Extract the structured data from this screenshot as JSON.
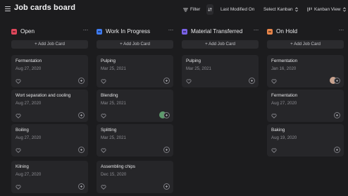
{
  "header": {
    "title": "Job cards board",
    "filter_label": "Filter",
    "sort_label": "Last Modified On",
    "select_kanban_label": "Select Kanban",
    "view_label": "Kanban View"
  },
  "columns": [
    {
      "title": "Open",
      "color": "#e0485c",
      "add_label": "+ Add Job Card",
      "cards": [
        {
          "title": "Fermentation",
          "date": "Aug 27, 2020"
        },
        {
          "title": "Wort separation and cooling",
          "date": "Aug 27, 2020"
        },
        {
          "title": "Boiling",
          "date": "Aug 27, 2020"
        },
        {
          "title": "Kilning",
          "date": "Aug 27, 2020"
        }
      ]
    },
    {
      "title": "Work In Progress",
      "color": "#3e7bf0",
      "add_label": "+ Add Job Card",
      "cards": [
        {
          "title": "Pulping",
          "date": "Mar 25, 2021"
        },
        {
          "title": "Blending",
          "date": "Mar 25, 2021"
        },
        {
          "title": "Splitting",
          "date": "Mar 25, 2021"
        },
        {
          "title": "Assembling chips",
          "date": "Dec 15, 2020"
        }
      ]
    },
    {
      "title": "Material Transferred",
      "color": "#7a62e6",
      "add_label": "+ Add Job Card",
      "cards": [
        {
          "title": "Pulping",
          "date": "Mar 25, 2021"
        }
      ]
    },
    {
      "title": "On Hold",
      "color": "#e9864a",
      "add_label": "+ Add Job Card",
      "cards": [
        {
          "title": "Fermentation",
          "date": "Jan 16, 2020"
        },
        {
          "title": "Fermentation",
          "date": "Aug 27, 2020"
        },
        {
          "title": "Baking",
          "date": "Aug 19, 2020"
        }
      ]
    }
  ]
}
